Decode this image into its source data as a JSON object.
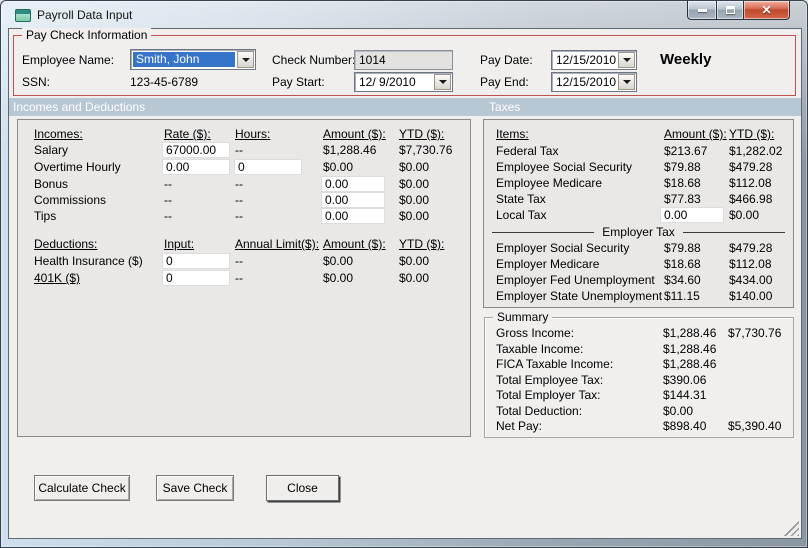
{
  "window": {
    "title": "Payroll Data Input"
  },
  "colors": {
    "paycheck_border": "#c0504d",
    "section_bar": "#b7c7d3",
    "selection_blue": "#3674c9",
    "close_button_red": "#c04a2d"
  },
  "paycheck": {
    "legend": "Pay Check Information",
    "employee_name": {
      "label": "Employee Name:",
      "value": "Smith, John"
    },
    "ssn": {
      "label": "SSN:",
      "value": "123-45-6789"
    },
    "check_number": {
      "label": "Check Number:",
      "value": "1014"
    },
    "pay_start": {
      "label": "Pay Start:",
      "value": "12/ 9/2010"
    },
    "pay_date": {
      "label": "Pay Date:",
      "value": "12/15/2010"
    },
    "pay_end": {
      "label": "Pay End:",
      "value": "12/15/2010"
    },
    "frequency": "Weekly"
  },
  "section_bar": {
    "left": "Incomes and Deductions",
    "right": "Taxes"
  },
  "incomes": {
    "headers": {
      "item": "Incomes:",
      "rate": "Rate ($):",
      "hours": "Hours:",
      "amount": "Amount ($):",
      "ytd": "YTD ($):"
    },
    "rows": [
      {
        "label": "Salary",
        "rate": "67000.00",
        "hours": "--",
        "amount": "$1,288.46",
        "ytd": "$7,730.76"
      },
      {
        "label": "Overtime Hourly",
        "rate": "0.00",
        "hours": "0",
        "amount": "$0.00",
        "ytd": "$0.00"
      },
      {
        "label": "Bonus",
        "rate": "--",
        "hours": "--",
        "amount": "0.00",
        "ytd": "$0.00"
      },
      {
        "label": "Commissions",
        "rate": "--",
        "hours": "--",
        "amount": "0.00",
        "ytd": "$0.00"
      },
      {
        "label": "Tips",
        "rate": "--",
        "hours": "--",
        "amount": "0.00",
        "ytd": "$0.00"
      }
    ]
  },
  "deductions": {
    "headers": {
      "item": "Deductions:",
      "input": "Input:",
      "limit": "Annual Limit($):",
      "amount": "Amount ($):",
      "ytd": "YTD ($):"
    },
    "rows": [
      {
        "label": "Health Insurance  ($)",
        "input": "0",
        "limit": "--",
        "amount": "$0.00",
        "ytd": "$0.00"
      },
      {
        "label": "401K  ($)",
        "input": "0",
        "limit": "--",
        "amount": "$0.00",
        "ytd": "$0.00"
      }
    ]
  },
  "taxes": {
    "headers": {
      "item": "Items:",
      "amount": "Amount ($):",
      "ytd": "YTD ($):"
    },
    "employee_rows": [
      {
        "label": "Federal Tax",
        "amount": "$213.67",
        "ytd": "$1,282.02"
      },
      {
        "label": "Employee Social Security",
        "amount": "$79.88",
        "ytd": "$479.28"
      },
      {
        "label": "Employee Medicare",
        "amount": "$18.68",
        "ytd": "$112.08"
      },
      {
        "label": "State Tax",
        "amount": "$77.83",
        "ytd": "$466.98"
      },
      {
        "label": "Local Tax",
        "amount": "0.00",
        "ytd": "$0.00"
      }
    ],
    "employer_header": "Employer Tax",
    "employer_rows": [
      {
        "label": "Employer Social Security",
        "amount": "$79.88",
        "ytd": "$479.28"
      },
      {
        "label": "Employer Medicare",
        "amount": "$18.68",
        "ytd": "$112.08"
      },
      {
        "label": "Employer Fed Unemployment",
        "amount": "$34.60",
        "ytd": "$434.00"
      },
      {
        "label": "Employer State Unemployment",
        "amount": "$11.15",
        "ytd": "$140.00"
      }
    ]
  },
  "summary": {
    "legend": "Summary",
    "rows": [
      {
        "label": "Gross Income:",
        "amount": "$1,288.46",
        "ytd": "$7,730.76"
      },
      {
        "label": "Taxable Income:",
        "amount": "$1,288.46",
        "ytd": ""
      },
      {
        "label": "FICA Taxable Income:",
        "amount": "$1,288.46",
        "ytd": ""
      },
      {
        "label": "Total Employee Tax:",
        "amount": "$390.06",
        "ytd": ""
      },
      {
        "label": "Total Employer Tax:",
        "amount": "$144.31",
        "ytd": ""
      },
      {
        "label": "Total Deduction:",
        "amount": "$0.00",
        "ytd": ""
      },
      {
        "label": "Net Pay:",
        "amount": "$898.40",
        "ytd": "$5,390.40"
      }
    ]
  },
  "buttons": {
    "calculate": "Calculate Check",
    "save": "Save Check",
    "close": "Close"
  }
}
